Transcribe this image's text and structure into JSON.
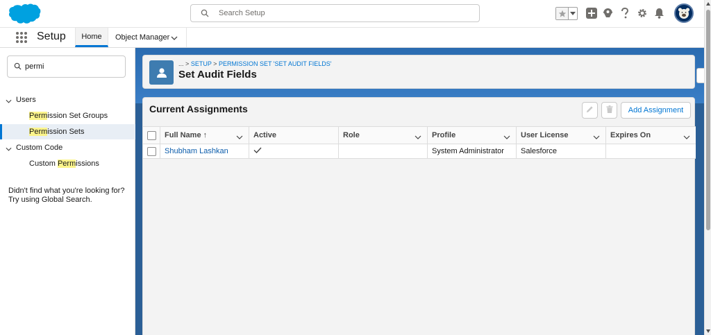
{
  "header": {
    "search_placeholder": "Search Setup",
    "icons": [
      "star-icon",
      "chevron-down-icon",
      "add-icon",
      "trailhead-icon",
      "help-icon",
      "gear-icon",
      "bell-icon",
      "avatar"
    ],
    "brand_color": "#00a1e0"
  },
  "context_bar": {
    "app_name": "Setup",
    "tabs": [
      {
        "label": "Home",
        "active": true
      },
      {
        "label": "Object Manager",
        "active": false
      }
    ]
  },
  "sidebar": {
    "quick_find_value": "permi",
    "tree": [
      {
        "label": "Users",
        "children": [
          {
            "hl": "Perm",
            "rest": "ission Set Groups",
            "selected": false
          },
          {
            "hl": "Perm",
            "rest": "ission Sets",
            "selected": true
          }
        ]
      },
      {
        "label": "Custom Code",
        "children": [
          {
            "pre": "Custom ",
            "hl": "Perm",
            "rest": "issions",
            "selected": false
          }
        ]
      }
    ],
    "not_found_text": "Didn't find what you're looking for? Try using Global Search."
  },
  "page_header": {
    "breadcrumb": {
      "dots": "...",
      "sep": ">",
      "items": [
        "SETUP",
        "PERMISSION SET 'SET AUDIT FIELDS'"
      ]
    },
    "title": "Set Audit Fields"
  },
  "assignments": {
    "title": "Current Assignments",
    "add_button": "Add Assignment",
    "columns": [
      "Full Name",
      "Active",
      "Role",
      "Profile",
      "User License",
      "Expires On"
    ],
    "sort_indicator": "↑",
    "rows": [
      {
        "full_name": "Shubham Lashkan",
        "active": true,
        "role": "",
        "profile": "System Administrator",
        "user_license": "Salesforce",
        "expires_on": ""
      }
    ]
  },
  "colors": {
    "accent": "#0176d3",
    "banner": "#2b5f96",
    "link": "#0b5cab",
    "highlight": "#fbf48b"
  }
}
